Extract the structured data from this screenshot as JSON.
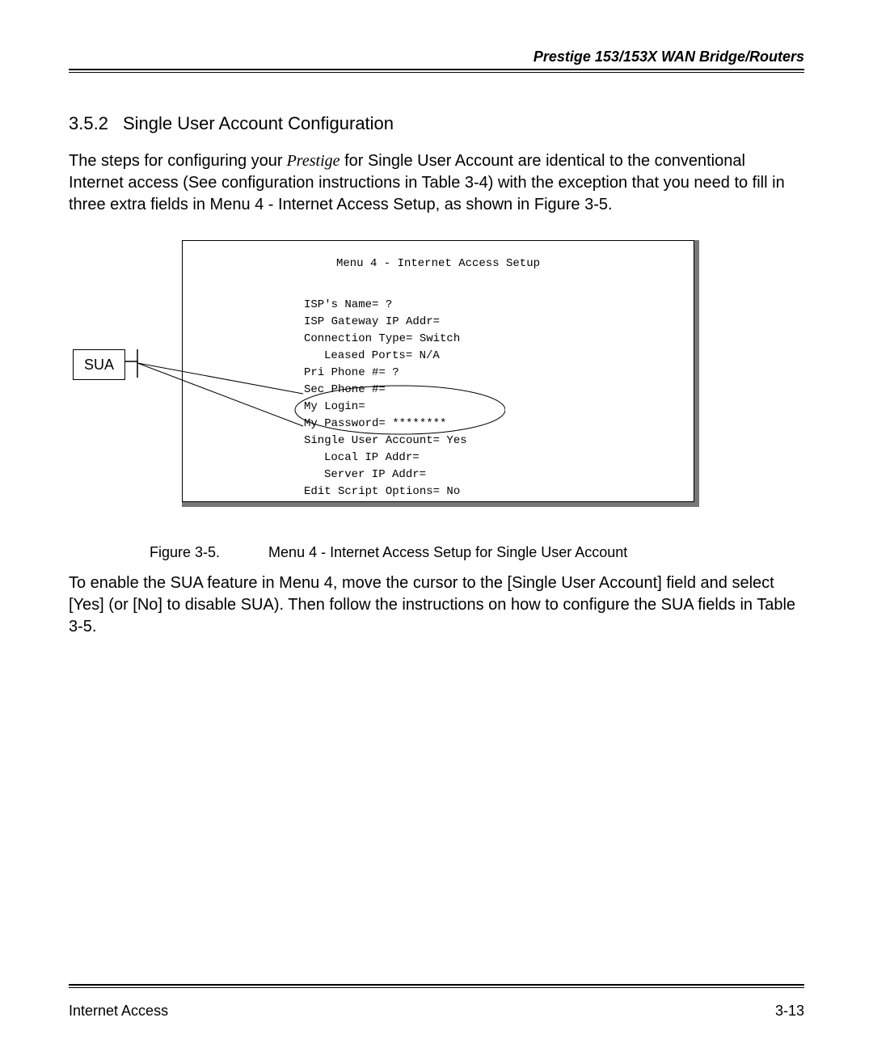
{
  "header": {
    "title": "Prestige 153/153X  WAN Bridge/Routers"
  },
  "section": {
    "number": "3.5.2",
    "title": "Single User Account Configuration"
  },
  "paragraph1": {
    "p1": "The steps for configuring your",
    "p2_italic": " Prestige",
    "p3": " for Single User Account are identical to the conventional Internet access (See configuration instructions in Table 3-4) with the exception that you need to fill in three extra fields in Menu 4 - Internet Access Setup, as shown in Figure 3-5."
  },
  "sua_label": "SUA",
  "terminal": {
    "title": "Menu 4 - Internet Access Setup",
    "lines": [
      {
        "text": "ISP's Name= ?",
        "indent": false
      },
      {
        "text": "ISP Gateway IP Addr=",
        "indent": false
      },
      {
        "text": "Connection Type= Switch",
        "indent": false
      },
      {
        "text": "Leased Ports= N/A",
        "indent": true
      },
      {
        "text": "Pri Phone #= ?",
        "indent": false
      },
      {
        "text": "Sec Phone #=",
        "indent": false
      },
      {
        "text": "My Login=",
        "indent": false
      },
      {
        "text": "My Password= ********",
        "indent": false
      },
      {
        "text": "Single User Account= Yes",
        "indent": false
      },
      {
        "text": "Local IP Addr=",
        "indent": true
      },
      {
        "text": "Server IP Addr=",
        "indent": true
      },
      {
        "text": "Edit Script Options= No",
        "indent": false
      }
    ]
  },
  "figure_caption": {
    "label": "Figure  3-5.",
    "text": "Menu 4 - Internet Access Setup for Single User Account"
  },
  "paragraph2": "To enable the SUA feature in Menu 4, move the cursor to the [Single User Account] field and select [Yes] (or [No] to disable SUA). Then follow the instructions on how to configure the SUA fields in Table 3-5.",
  "footer": {
    "left": "Internet Access",
    "right": "3-13"
  }
}
